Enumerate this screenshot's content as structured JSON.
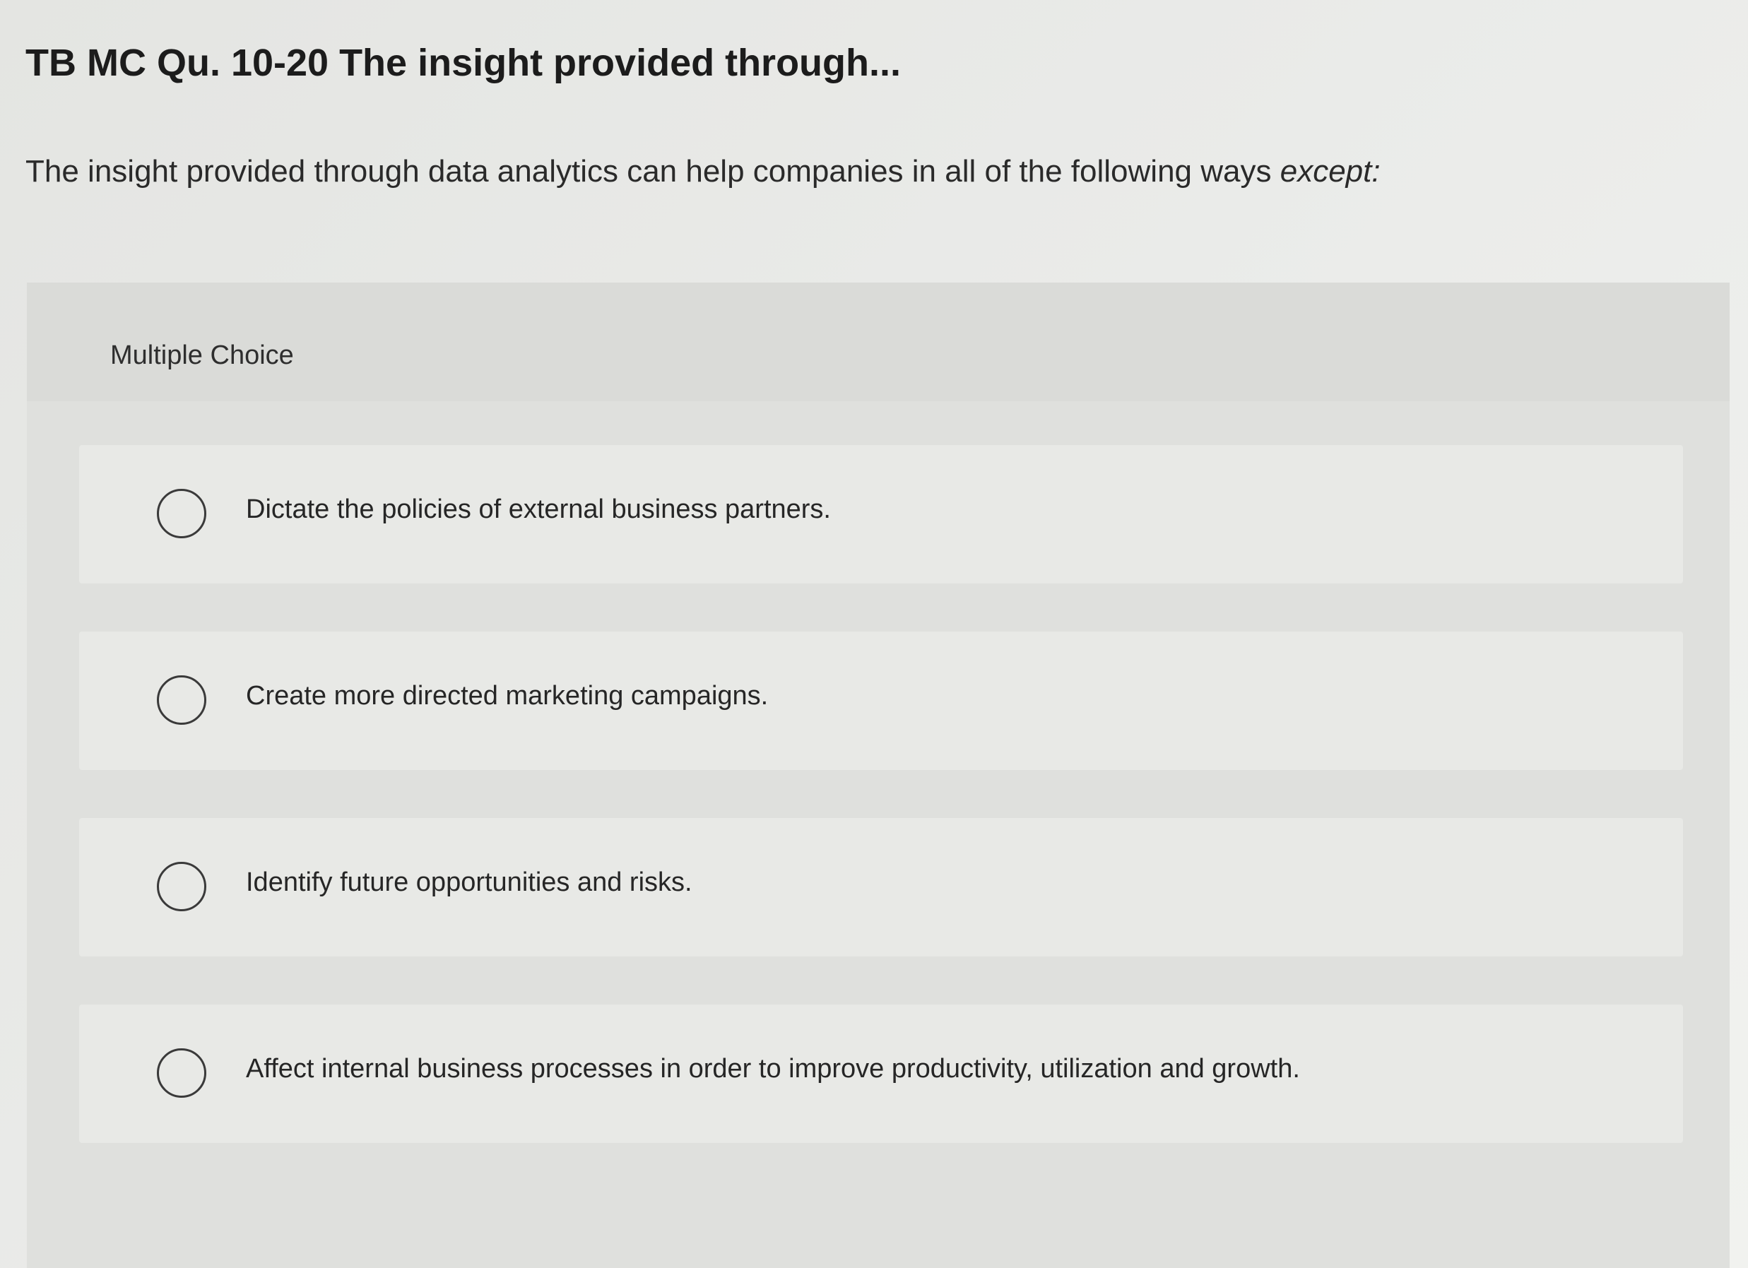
{
  "question": {
    "title": "TB MC Qu. 10-20 The insight provided through...",
    "prompt_main": "The insight provided through data analytics can help companies in all of the following ways ",
    "prompt_emphasis": "except:"
  },
  "panel": {
    "label": "Multiple Choice"
  },
  "options": [
    {
      "label": "Dictate the policies of external business partners.",
      "selected": false
    },
    {
      "label": "Create more directed marketing campaigns.",
      "selected": false
    },
    {
      "label": "Identify future opportunities and risks.",
      "selected": false
    },
    {
      "label": "Affect internal business processes in order to improve productivity, utilization and growth.",
      "selected": false
    }
  ]
}
